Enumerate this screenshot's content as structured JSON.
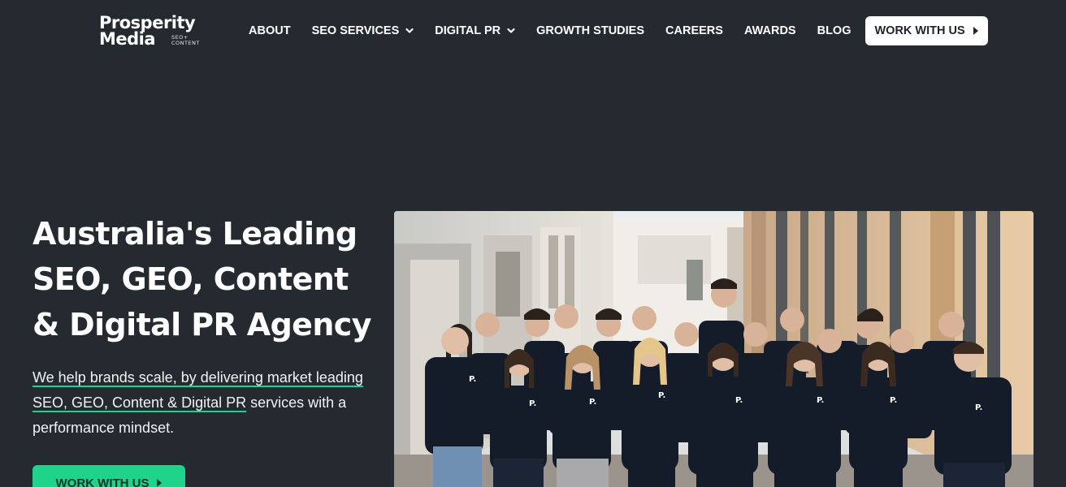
{
  "brand": {
    "logo_line1": "Prosperity",
    "logo_line2": "Media",
    "logo_tag_1": "SEO+",
    "logo_tag_2": "CONTENT"
  },
  "nav": {
    "items": [
      {
        "label": "ABOUT",
        "dropdown": false
      },
      {
        "label": "SEO SERVICES",
        "dropdown": true
      },
      {
        "label": "DIGITAL PR",
        "dropdown": true
      },
      {
        "label": "GROWTH STUDIES",
        "dropdown": false
      },
      {
        "label": "CAREERS",
        "dropdown": false
      },
      {
        "label": "AWARDS",
        "dropdown": false
      },
      {
        "label": "BLOG",
        "dropdown": false
      }
    ],
    "cta_label": "WORK WITH US"
  },
  "hero": {
    "title_lines": [
      "Australia's Leading",
      "SEO, GEO, Content",
      "& Digital PR Agency"
    ],
    "desc_highlight": "We help brands scale, by delivering market leading SEO, GEO, Content & Digital PR",
    "desc_rest": " services with a performance mindset.",
    "cta_label": "WORK WITH US"
  },
  "colors": {
    "background": "#252a31",
    "accent": "#1fd38b",
    "shirt": "#141c2a"
  },
  "icons": {
    "dropdown": "chevron-down-icon",
    "cta_arrow": "play-arrow-icon"
  }
}
